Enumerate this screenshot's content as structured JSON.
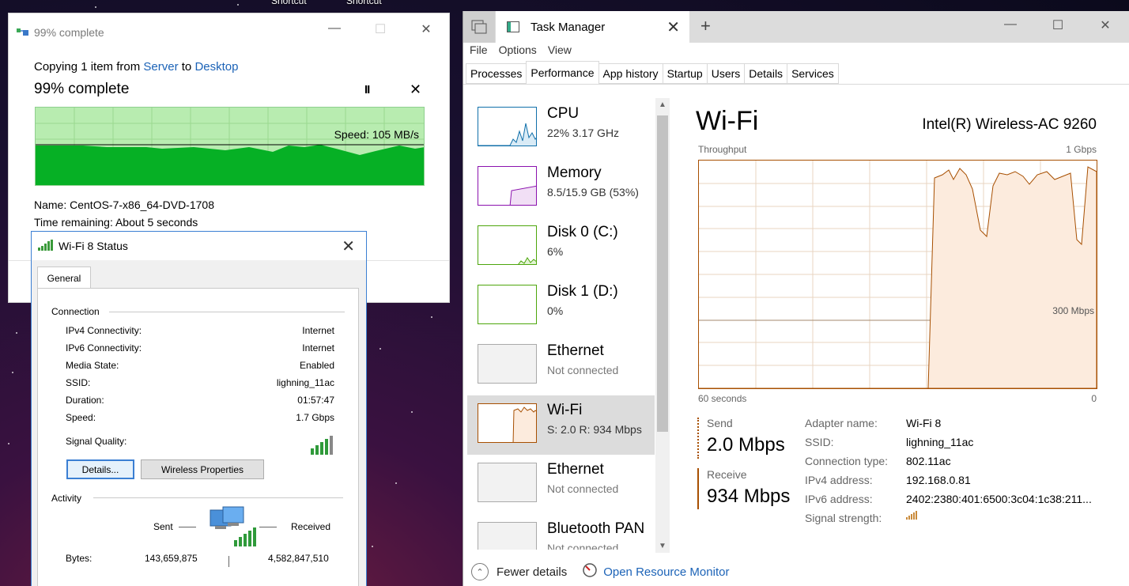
{
  "desktop": {
    "shortcut1": "Shortcut",
    "shortcut2": "Shortcut"
  },
  "copy_dialog": {
    "title": "99% complete",
    "copy_prefix": "Copying 1 item from",
    "from": "Server",
    "to_word": "to",
    "to": "Desktop",
    "percent": "99% complete",
    "pause": "II",
    "cancel": "✕",
    "progress": 0.99,
    "speed": "Speed: 105 MB/s",
    "name": "Name:  CentOS-7-x86_64-DVD-1708",
    "remaining": "Time remaining:  About 5 seconds",
    "colors": {
      "fill": "#06b025",
      "bg": "#b8ecb0"
    }
  },
  "wifi_status": {
    "title": "Wi-Fi 8 Status",
    "tab": "General",
    "connection_label": "Connection",
    "rows": [
      {
        "k": "IPv4 Connectivity:",
        "v": "Internet"
      },
      {
        "k": "IPv6 Connectivity:",
        "v": "Internet"
      },
      {
        "k": "Media State:",
        "v": "Enabled"
      },
      {
        "k": "SSID:",
        "v": "lighning_11ac"
      },
      {
        "k": "Duration:",
        "v": "01:57:47"
      },
      {
        "k": "Speed:",
        "v": "1.7 Gbps"
      }
    ],
    "signal_label": "Signal Quality:",
    "details_btn": "Details...",
    "wireless_btn": "Wireless Properties",
    "activity_label": "Activity",
    "sent": "Sent",
    "received": "Received",
    "bytes_label": "Bytes:",
    "bytes_sent": "143,659,875",
    "bytes_recv": "4,582,847,510"
  },
  "task_manager": {
    "title": "Task Manager",
    "menu": [
      "File",
      "Options",
      "View"
    ],
    "tabs": [
      "Processes",
      "Performance",
      "App history",
      "Startup",
      "Users",
      "Details",
      "Services"
    ],
    "active_tab": "Performance",
    "sidebar": [
      {
        "name": "CPU",
        "sub": "22%  3.17 GHz",
        "color": "#1170aa"
      },
      {
        "name": "Memory",
        "sub": "8.5/15.9 GB (53%)",
        "color": "#8b12ae"
      },
      {
        "name": "Disk 0 (C:)",
        "sub": "6%",
        "color": "#4da60c"
      },
      {
        "name": "Disk 1 (D:)",
        "sub": "0%",
        "color": "#4da60c"
      },
      {
        "name": "Ethernet",
        "sub": "Not connected",
        "color": "#aaaaaa"
      },
      {
        "name": "Wi-Fi",
        "sub": "S: 2.0  R: 934 Mbps",
        "color": "#a74f01"
      },
      {
        "name": "Ethernet",
        "sub": "Not connected",
        "color": "#aaaaaa"
      },
      {
        "name": "Bluetooth PAN",
        "sub": "Not connected",
        "color": "#aaaaaa"
      }
    ],
    "detail": {
      "title": "Wi-Fi",
      "adapter": "Intel(R) Wireless-AC 9260",
      "throughput_label": "Throughput",
      "max_label": "1 Gbps",
      "mid_label": "300 Mbps",
      "time_label": "60 seconds",
      "zero_label": "0",
      "send_label": "Send",
      "send_val": "2.0 Mbps",
      "recv_label": "Receive",
      "recv_val": "934 Mbps",
      "props": [
        {
          "k": "Adapter name:",
          "v": "Wi-Fi 8"
        },
        {
          "k": "SSID:",
          "v": "lighning_11ac"
        },
        {
          "k": "Connection type:",
          "v": "802.11ac"
        },
        {
          "k": "IPv4 address:",
          "v": "192.168.0.81"
        },
        {
          "k": "IPv6 address:",
          "v": "2402:2380:401:6500:3c04:1c38:211..."
        },
        {
          "k": "Signal strength:",
          "v": ""
        }
      ]
    },
    "fewer_details": "Fewer details",
    "open_resource_monitor": "Open Resource Monitor",
    "accent": "#a74f01"
  }
}
